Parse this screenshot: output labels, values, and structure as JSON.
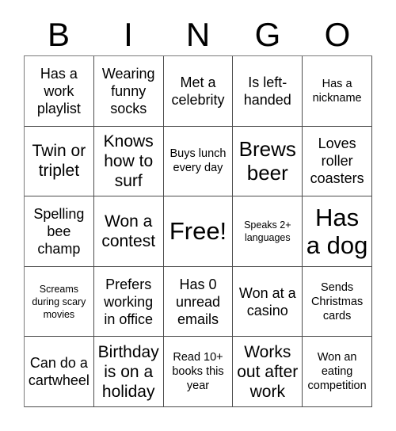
{
  "card": {
    "title": "BINGO",
    "header_letters": [
      "B",
      "I",
      "N",
      "G",
      "O"
    ],
    "columns": 5,
    "rows": 5,
    "border_color": "#4d4d4d",
    "text_color": "#000000",
    "background_color": "#ffffff"
  },
  "cells": [
    {
      "id": "b1",
      "column": "B",
      "row": 1,
      "text": "Has a work playlist",
      "size": "md",
      "free": false
    },
    {
      "id": "i1",
      "column": "I",
      "row": 1,
      "text": "Wearing funny socks",
      "size": "md",
      "free": false
    },
    {
      "id": "n1",
      "column": "N",
      "row": 1,
      "text": "Met a celebrity",
      "size": "md",
      "free": false
    },
    {
      "id": "g1",
      "column": "G",
      "row": 1,
      "text": "Is left-handed",
      "size": "md",
      "free": false
    },
    {
      "id": "o1",
      "column": "O",
      "row": 1,
      "text": "Has a nickname",
      "size": "sm",
      "free": false
    },
    {
      "id": "b2",
      "column": "B",
      "row": 2,
      "text": "Twin or triplet",
      "size": "lg",
      "free": false
    },
    {
      "id": "i2",
      "column": "I",
      "row": 2,
      "text": "Knows how to surf",
      "size": "lg",
      "free": false
    },
    {
      "id": "n2",
      "column": "N",
      "row": 2,
      "text": "Buys lunch every day",
      "size": "sm",
      "free": false
    },
    {
      "id": "g2",
      "column": "G",
      "row": 2,
      "text": "Brews beer",
      "size": "xl",
      "free": false
    },
    {
      "id": "o2",
      "column": "O",
      "row": 2,
      "text": "Loves roller coasters",
      "size": "md",
      "free": false
    },
    {
      "id": "b3",
      "column": "B",
      "row": 3,
      "text": "Spelling bee champ",
      "size": "md",
      "free": false
    },
    {
      "id": "i3",
      "column": "I",
      "row": 3,
      "text": "Won a contest",
      "size": "lg",
      "free": false
    },
    {
      "id": "n3",
      "column": "N",
      "row": 3,
      "text": "Free!",
      "size": "xxl",
      "free": true
    },
    {
      "id": "g3",
      "column": "G",
      "row": 3,
      "text": "Speaks 2+ languages",
      "size": "xs",
      "free": false
    },
    {
      "id": "o3",
      "column": "O",
      "row": 3,
      "text": "Has a dog",
      "size": "xxl",
      "free": false
    },
    {
      "id": "b4",
      "column": "B",
      "row": 4,
      "text": "Screams during scary movies",
      "size": "xs",
      "free": false
    },
    {
      "id": "i4",
      "column": "I",
      "row": 4,
      "text": "Prefers working in office",
      "size": "md",
      "free": false
    },
    {
      "id": "n4",
      "column": "N",
      "row": 4,
      "text": "Has 0 unread emails",
      "size": "md",
      "free": false
    },
    {
      "id": "g4",
      "column": "G",
      "row": 4,
      "text": "Won at a casino",
      "size": "md",
      "free": false
    },
    {
      "id": "o4",
      "column": "O",
      "row": 4,
      "text": "Sends Christmas cards",
      "size": "sm",
      "free": false
    },
    {
      "id": "b5",
      "column": "B",
      "row": 5,
      "text": "Can do a cartwheel",
      "size": "md",
      "free": false
    },
    {
      "id": "i5",
      "column": "I",
      "row": 5,
      "text": "Birthday is on a holiday",
      "size": "lg",
      "free": false
    },
    {
      "id": "n5",
      "column": "N",
      "row": 5,
      "text": "Read 10+ books this year",
      "size": "sm",
      "free": false
    },
    {
      "id": "g5",
      "column": "G",
      "row": 5,
      "text": "Works out after work",
      "size": "lg",
      "free": false
    },
    {
      "id": "o5",
      "column": "O",
      "row": 5,
      "text": "Won an eating competition",
      "size": "sm",
      "free": false
    }
  ]
}
